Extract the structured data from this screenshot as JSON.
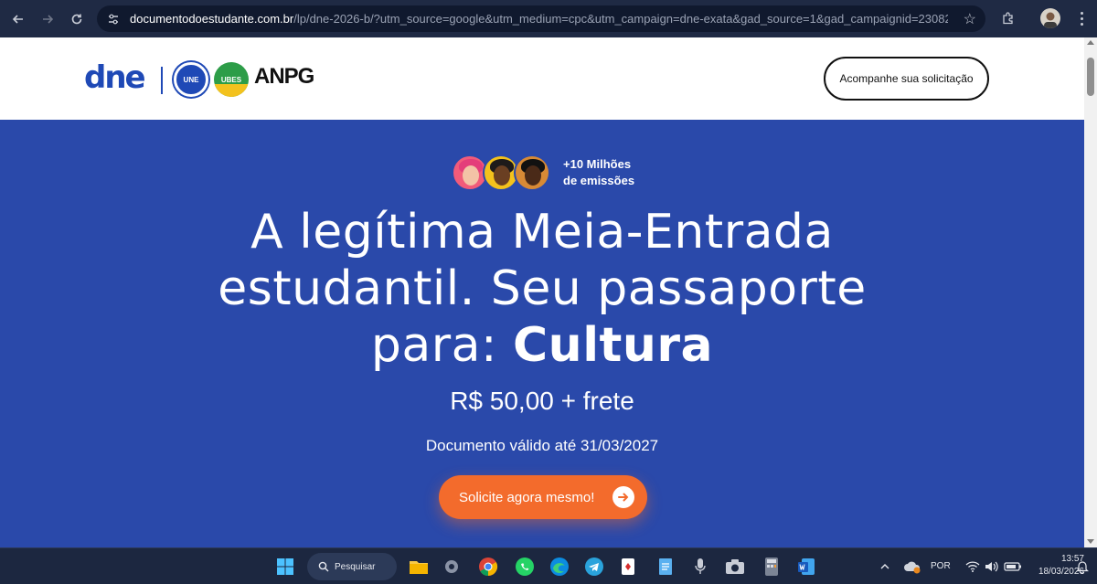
{
  "browser": {
    "url_domain": "documentodoestudante.com.br",
    "url_path": "/lp/dne-2026-b/?utm_source=google&utm_medium=cpc&utm_campaign=dne-exata&gad_source=1&gad_campaignid=230822987..."
  },
  "header": {
    "logo_text": "dne",
    "partner_logos": [
      "UNE",
      "UBES",
      "ANPG"
    ],
    "track_button": "Acompanhe sua solicitação"
  },
  "hero": {
    "emissions_line1": "+10 Milhões",
    "emissions_line2": "de emissões",
    "headline_line1": "A legítima Meia-Entrada",
    "headline_line2": "estudantil. Seu passaporte",
    "headline_line3_prefix": "para: ",
    "headline_line3_bold": "Cultura",
    "price": "R$ 50,00 + frete",
    "validity": "Documento válido até 31/03/2027",
    "cta": "Solicite agora mesmo!"
  },
  "taskbar": {
    "search_label": "Pesquisar",
    "language": "POR",
    "time": "13:57",
    "date": "18/03/2026"
  },
  "colors": {
    "brand_blue": "#2a49aa",
    "cta_orange": "#f36b2c"
  }
}
